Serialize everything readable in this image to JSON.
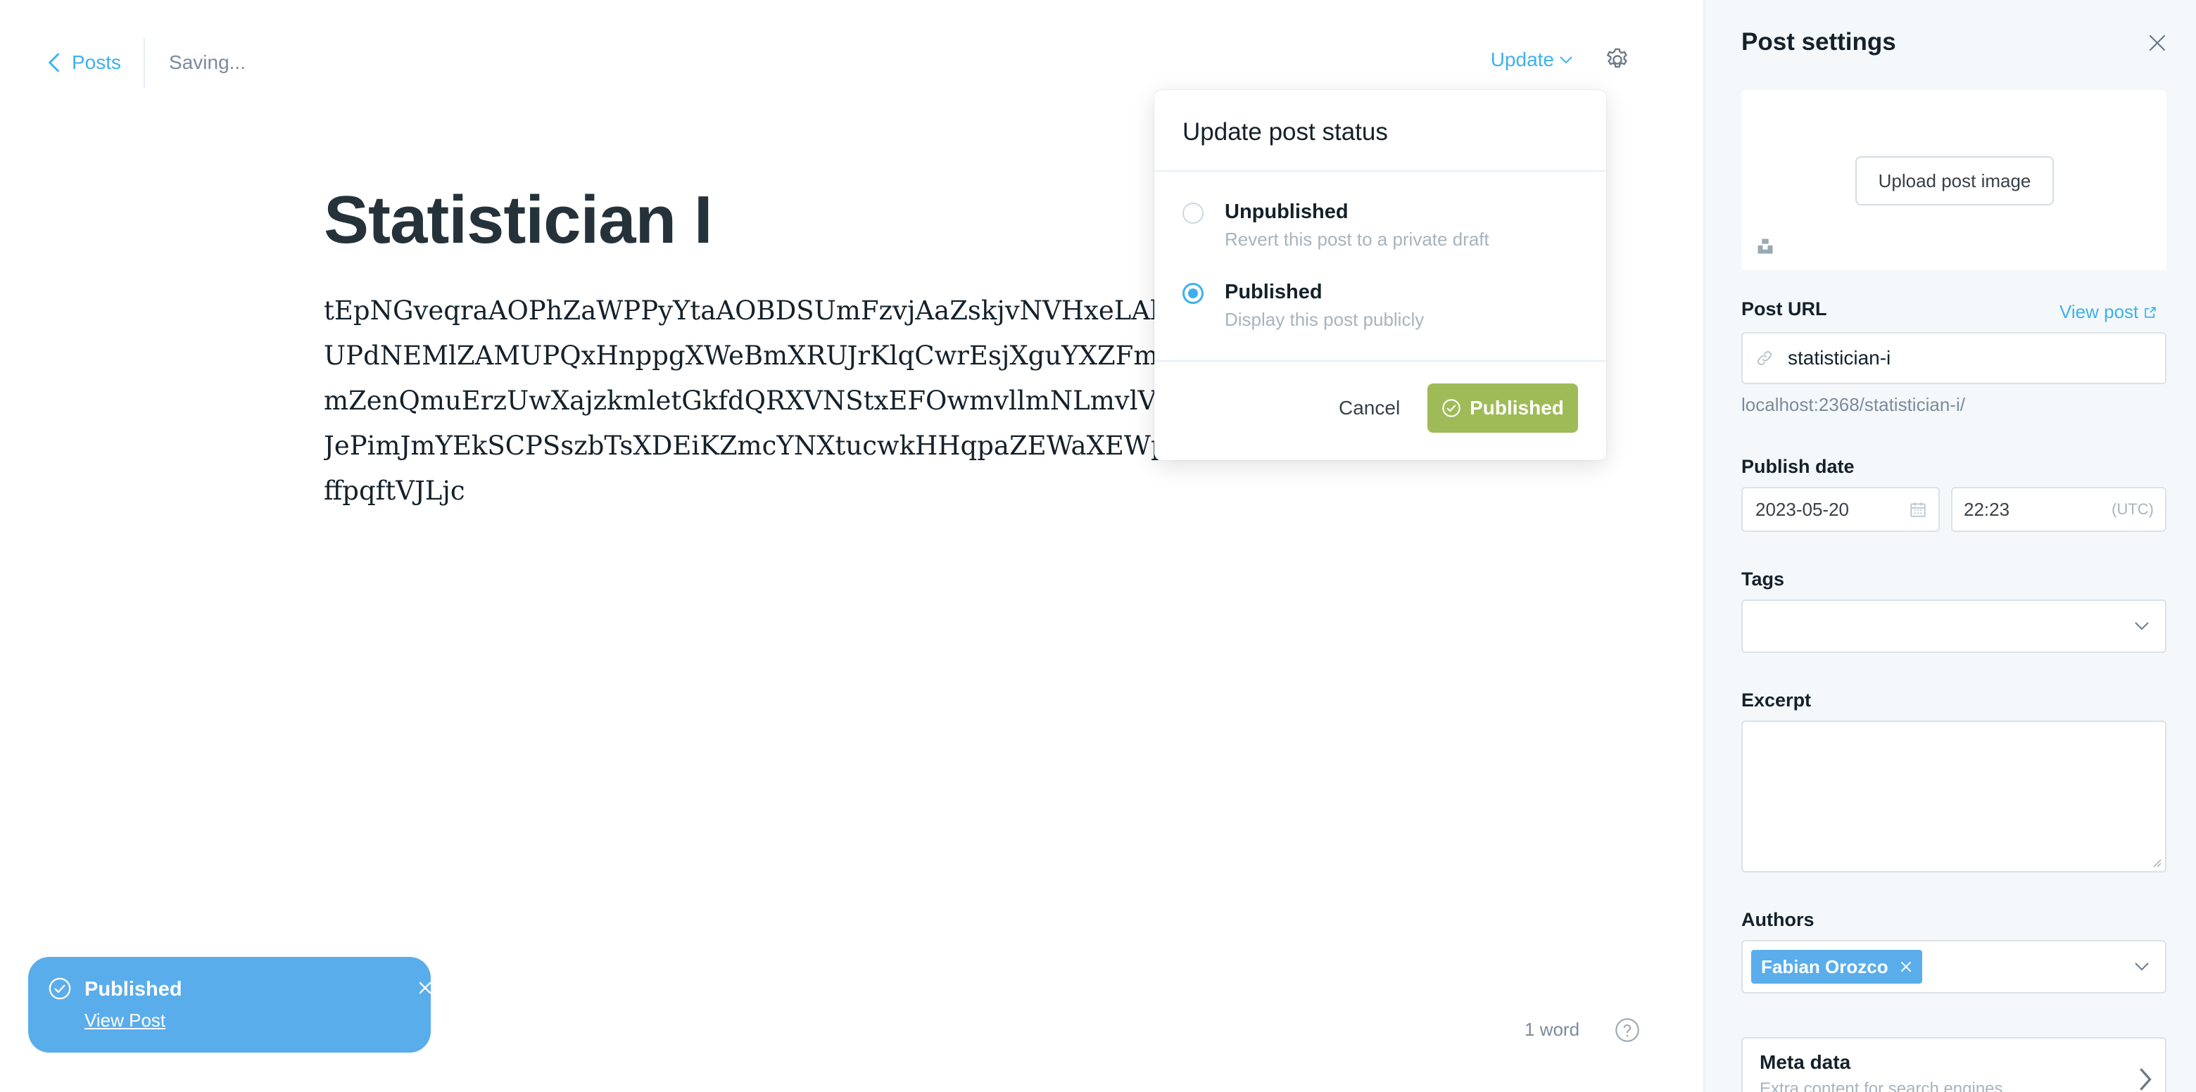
{
  "topbar": {
    "back_label": "Posts",
    "status": "Saving...",
    "update_label": "Update"
  },
  "post": {
    "title": "Statistician I",
    "body_lines": [
      "tEpNGveqraAOPhZaWPPyYtaAOBDSUmFzvjAaZskjvNVHxeLAkq",
      "UPdNEMlZAMUPQxHnppgXWeBmXRUJrKlqCwrEsjXguYXZFm",
      "mZenQmuErzUwXajzkmletGkfdQRXVNStxEFOwmvllmNLmvlVF",
      "JePimJmYEkSCPSszbTsXDEiKZmcYNXtucwkHHqpaZEWaXEWp",
      "ffpqftVJLjc"
    ]
  },
  "footer": {
    "word_count": "1 word"
  },
  "popover": {
    "title": "Update post status",
    "options": [
      {
        "label": "Unpublished",
        "desc": "Revert this post to a private draft",
        "checked": false
      },
      {
        "label": "Published",
        "desc": "Display this post publicly",
        "checked": true
      }
    ],
    "cancel_label": "Cancel",
    "confirm_label": "Published"
  },
  "toast": {
    "title": "Published",
    "link": "View Post"
  },
  "sidebar": {
    "title": "Post settings",
    "upload_label": "Upload post image",
    "post_url_label": "Post URL",
    "view_post_label": "View post",
    "slug": "statistician-i",
    "url_preview": "localhost:2368/statistician-i/",
    "publish_date_label": "Publish date",
    "date": "2023-05-20",
    "time": "22:23",
    "timezone": "(UTC)",
    "tags_label": "Tags",
    "excerpt_label": "Excerpt",
    "authors_label": "Authors",
    "author": "Fabian Orozco",
    "meta_title": "Meta data",
    "meta_desc": "Extra content for search engines"
  },
  "colors": {
    "accent": "#3eb0ef",
    "publish_green": "#9fbb58",
    "toast_blue": "#5aadeb"
  }
}
